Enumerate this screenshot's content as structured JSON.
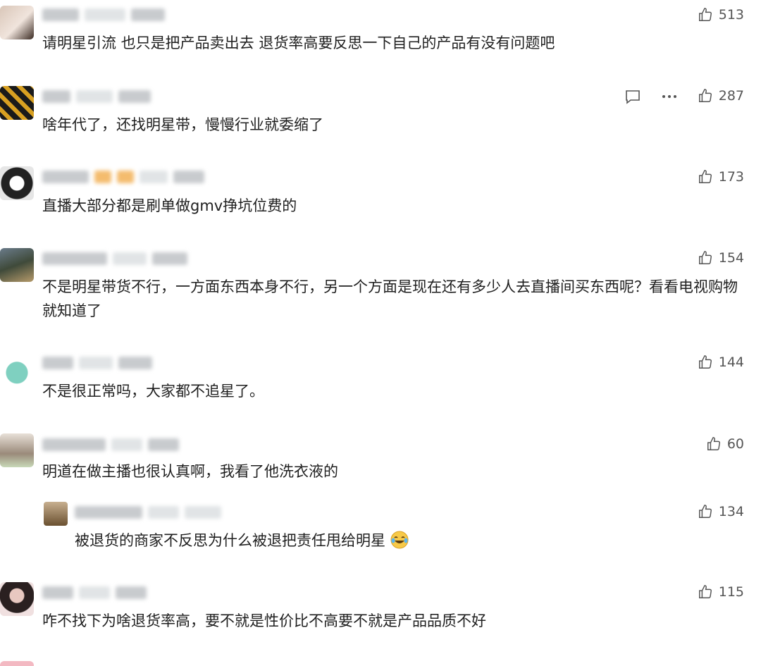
{
  "comments": [
    {
      "text": "请明星引流 也只是把产品卖出去  退货率高要反思一下自己的产品有没有问题吧",
      "likes": "513"
    },
    {
      "text": "啥年代了，还找明星带，慢慢行业就委缩了",
      "likes": "287"
    },
    {
      "text": "直播大部分都是刷单做gmv挣坑位费的",
      "likes": "173"
    },
    {
      "text": "不是明星带货不行，一方面东西本身不行，另一个方面是现在还有多少人去直播间买东西呢？看看电视购物就知道了",
      "likes": "154"
    },
    {
      "text": "不是很正常吗，大家都不追星了。",
      "likes": "144"
    },
    {
      "text": "明道在做主播也很认真啊，我看了他洗衣液的",
      "likes": "60"
    }
  ],
  "reply": {
    "text": "被退货的商家不反思为什么被退把责任甩给明星",
    "likes": "134"
  },
  "last": {
    "text": "咋不找下为啥退货率高，要不就是性价比不高要不就是产品品质不好",
    "likes": "115"
  },
  "colors": {
    "text": "#1f1f1f",
    "meta": "#9aa0a6",
    "icon": "#555555"
  }
}
